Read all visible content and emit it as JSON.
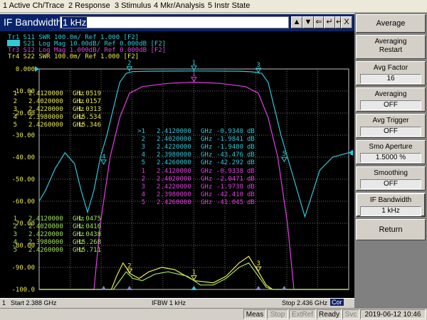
{
  "menu": [
    {
      "label": "1 Active Ch/Trace"
    },
    {
      "label": "2 Response"
    },
    {
      "label": "3 Stimulus"
    },
    {
      "label": "4 Mkr/Analysis"
    },
    {
      "label": "5 Instr State"
    }
  ],
  "entry": {
    "label": "IF Bandwidth",
    "value": "1 kHz",
    "buttons": [
      "▲",
      "▼",
      "⇐",
      "↵",
      "↵",
      "X"
    ]
  },
  "traces": [
    {
      "label": "Tr1  S11  SWR 100.0m/ Ref 1.000  [F2]",
      "color": "#30c8d8"
    },
    {
      "label": "Tr2  S21  Log Mag 10.00dB/ Ref 0.000dB  [F2]",
      "color": "#30c8d8"
    },
    {
      "label": "Tr3  S12  Log Mag 1.000dB/ Ref 0.000dB  [F2]",
      "color": "#e040e0"
    },
    {
      "label": "Tr4  S22  SWR 100.0m/ Ref 1.000  [F2]",
      "color": "#e8e850"
    }
  ],
  "chart_data": {
    "type": "line",
    "x_start_ghz": 2.388,
    "x_stop_ghz": 2.436,
    "ylim": [
      -100,
      0
    ],
    "yticks": [
      "0.000",
      "-10.00",
      "-20.00",
      "-30.00",
      "-40.00",
      "-50.00",
      "-60.00",
      "-70.00",
      "-80.00",
      "-90.00",
      "-100.0"
    ],
    "grid": true,
    "series": [
      {
        "color": "#30c8d8",
        "points": [
          [
            2.388,
            -60
          ],
          [
            2.389,
            -55
          ],
          [
            2.3905,
            -45
          ],
          [
            2.392,
            -38
          ],
          [
            2.3935,
            -43
          ],
          [
            2.3945,
            -55
          ],
          [
            2.3955,
            -65
          ],
          [
            2.3965,
            -55
          ],
          [
            2.3975,
            -40
          ],
          [
            2.3985,
            -30
          ],
          [
            2.3995,
            -18
          ],
          [
            2.4005,
            -6
          ],
          [
            2.4015,
            -2
          ],
          [
            2.4025,
            -1.2
          ],
          [
            2.405,
            -1
          ],
          [
            2.412,
            -0.9
          ],
          [
            2.419,
            -1
          ],
          [
            2.421,
            -1.3
          ],
          [
            2.4225,
            -2
          ],
          [
            2.4235,
            -6
          ],
          [
            2.4245,
            -18
          ],
          [
            2.4255,
            -30
          ],
          [
            2.4265,
            -40
          ],
          [
            2.4275,
            -50
          ],
          [
            2.4285,
            -60
          ],
          [
            2.4292,
            -67
          ],
          [
            2.4302,
            -58
          ],
          [
            2.4315,
            -46
          ],
          [
            2.4335,
            -40
          ],
          [
            2.436,
            -38
          ]
        ]
      },
      {
        "color": "#e040e0",
        "points": [
          [
            2.388,
            -100
          ],
          [
            2.3965,
            -100
          ],
          [
            2.3975,
            -70
          ],
          [
            2.399,
            -40
          ],
          [
            2.4005,
            -22
          ],
          [
            2.402,
            -11
          ],
          [
            2.404,
            -8
          ],
          [
            2.408,
            -6.5
          ],
          [
            2.412,
            -6
          ],
          [
            2.416,
            -6.5
          ],
          [
            2.42,
            -8
          ],
          [
            2.422,
            -11
          ],
          [
            2.4235,
            -22
          ],
          [
            2.425,
            -40
          ],
          [
            2.4265,
            -70
          ],
          [
            2.4275,
            -100
          ],
          [
            2.436,
            -100
          ]
        ]
      },
      {
        "color": "#e8e850",
        "points": [
          [
            2.388,
            -100
          ],
          [
            2.3992,
            -100
          ],
          [
            2.4,
            -94
          ],
          [
            2.401,
            -88
          ],
          [
            2.4022,
            -93
          ],
          [
            2.4035,
            -95
          ],
          [
            2.405,
            -92
          ],
          [
            2.407,
            -90
          ],
          [
            2.409,
            -91
          ],
          [
            2.412,
            -96
          ],
          [
            2.415,
            -97
          ],
          [
            2.417,
            -94
          ],
          [
            2.419,
            -88
          ],
          [
            2.4205,
            -85
          ],
          [
            2.422,
            -92
          ],
          [
            2.4232,
            -98
          ],
          [
            2.4242,
            -100
          ],
          [
            2.436,
            -100
          ]
        ]
      },
      {
        "color": "#a0e060",
        "points": [
          [
            2.388,
            -100
          ],
          [
            2.3995,
            -100
          ],
          [
            2.4005,
            -96
          ],
          [
            2.4015,
            -92
          ],
          [
            2.4025,
            -95
          ],
          [
            2.404,
            -96
          ],
          [
            2.406,
            -93
          ],
          [
            2.408,
            -92
          ],
          [
            2.411,
            -94
          ],
          [
            2.413,
            -98
          ],
          [
            2.415,
            -98
          ],
          [
            2.417,
            -95
          ],
          [
            2.419,
            -90
          ],
          [
            2.4205,
            -88
          ],
          [
            2.422,
            -94
          ],
          [
            2.4232,
            -99
          ],
          [
            2.4242,
            -100
          ],
          [
            2.436,
            -100
          ]
        ]
      }
    ],
    "marker_tables": [
      {
        "color": "#e8e850",
        "rows": [
          [
            "1",
            "2.4120000",
            "GHz",
            "1.0519"
          ],
          [
            "2",
            "2.4020000",
            "GHz",
            "1.0157"
          ],
          [
            "3",
            "2.4220000",
            "GHz",
            "1.0313"
          ],
          [
            "4",
            "2.3980000",
            "GHz",
            "15.534"
          ],
          [
            "5",
            "2.4260000",
            "GHz",
            "15.346"
          ]
        ]
      },
      {
        "color": "#30c8d8",
        "rows": [
          [
            ">1",
            "2.4120000",
            "GHz",
            "-0.9340",
            "dB"
          ],
          [
            "2",
            "2.4020000",
            "GHz",
            "-1.9841",
            "dB"
          ],
          [
            "3",
            "2.4220000",
            "GHz",
            "-1.9480",
            "dB"
          ],
          [
            "4",
            "2.3980000",
            "GHz",
            "-43.476",
            "dB"
          ],
          [
            "5",
            "2.4260000",
            "GHz",
            "-42.292",
            "dB"
          ]
        ]
      },
      {
        "color": "#e040e0",
        "rows": [
          [
            "1",
            "2.4120000",
            "GHz",
            "-0.9338",
            "dB"
          ],
          [
            "2",
            "2.4020000",
            "GHz",
            "-2.0471",
            "dB"
          ],
          [
            "3",
            "2.4220000",
            "GHz",
            "-1.9730",
            "dB"
          ],
          [
            "4",
            "2.3980000",
            "GHz",
            "-42.410",
            "dB"
          ],
          [
            "5",
            "2.4260000",
            "GHz",
            "-41.045",
            "dB"
          ]
        ]
      },
      {
        "color": "#a0e060",
        "rows": [
          [
            "1",
            "2.4120000",
            "GHz",
            "1.0475"
          ],
          [
            "2",
            "2.4020000",
            "GHz",
            "1.0416"
          ],
          [
            "3",
            "2.4220000",
            "GHz",
            "1.0438"
          ],
          [
            "4",
            "2.3980000",
            "GHz",
            "15.268"
          ],
          [
            "5",
            "2.4260000",
            "GHz",
            "15.711"
          ]
        ]
      }
    ],
    "markers": [
      {
        "label": "1",
        "x": 2.412,
        "y": -0.9,
        "color": "#30c8d8"
      },
      {
        "label": "2",
        "x": 2.402,
        "y": -1.2,
        "color": "#30c8d8"
      },
      {
        "label": "3",
        "x": 2.422,
        "y": -1.9,
        "color": "#30c8d8"
      },
      {
        "label": "4",
        "x": 2.398,
        "y": -43.5,
        "color": "#30c8d8"
      },
      {
        "label": "5",
        "x": 2.426,
        "y": -42.3,
        "color": "#30c8d8"
      },
      {
        "label": "1",
        "x": 2.412,
        "y": -6,
        "color": "#e040e0"
      },
      {
        "label": "1",
        "x": 2.412,
        "y": -96,
        "color": "#e8e850"
      },
      {
        "label": "2",
        "x": 2.402,
        "y": -93,
        "color": "#e8e850"
      },
      {
        "label": "3",
        "x": 2.422,
        "y": -92,
        "color": "#e8e850"
      }
    ]
  },
  "status": {
    "channel": "1",
    "start": "Start 2.388 GHz",
    "ifbw": "IFBW 1 kHz",
    "stop": "Stop 2.436 GHz",
    "cor": "Cor"
  },
  "taskbar": {
    "meas": "Meas",
    "stop": "Stop",
    "extref": "ExtRef",
    "ready": "Ready",
    "svc": "Svc",
    "datetime": "2019-06-12 10:46"
  },
  "softkeys": {
    "header": "Average",
    "averaging_restart": "Averaging Restart",
    "avg_factor_label": "Avg Factor",
    "avg_factor_value": "16",
    "averaging_label": "Averaging",
    "averaging_value": "OFF",
    "avg_trigger_label": "Avg Trigger",
    "avg_trigger_value": "OFF",
    "smo_aperture_label": "Smo Aperture",
    "smo_aperture_value": "1.5000 %",
    "smoothing_label": "Smoothing",
    "smoothing_value": "OFF",
    "if_bandwidth_label": "IF Bandwidth",
    "if_bandwidth_value": "1 kHz",
    "return": "Return"
  }
}
